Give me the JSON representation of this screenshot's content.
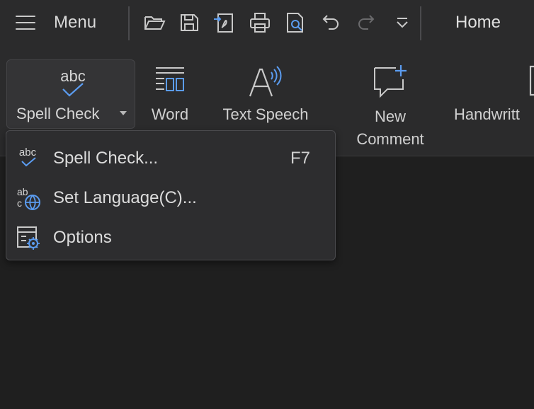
{
  "topbar": {
    "menu_label": "Menu",
    "home_tab": "Home",
    "quick_access": [
      "open-folder-icon",
      "save-icon",
      "export-pdf-icon",
      "print-icon",
      "print-preview-icon",
      "undo-icon",
      "redo-icon",
      "more-dropdown-icon"
    ]
  },
  "ribbon": {
    "spell_check": "Spell Check",
    "word": "Word",
    "text_speech": "Text Speech",
    "new_comment_line1": "New",
    "new_comment_line2": "Comment",
    "handwriting": "Handwritt"
  },
  "dropdown": {
    "items": [
      {
        "label": "Spell Check...",
        "shortcut": "F7",
        "icon": "spell-check-icon"
      },
      {
        "label": "Set Language(C)...",
        "shortcut": "",
        "icon": "language-globe-icon"
      },
      {
        "label": "Options",
        "shortcut": "",
        "icon": "options-settings-icon"
      }
    ]
  },
  "colors": {
    "background": "#1f1f1f",
    "toolbar": "#2b2b2c",
    "accent_blue": "#5b9cf0"
  }
}
